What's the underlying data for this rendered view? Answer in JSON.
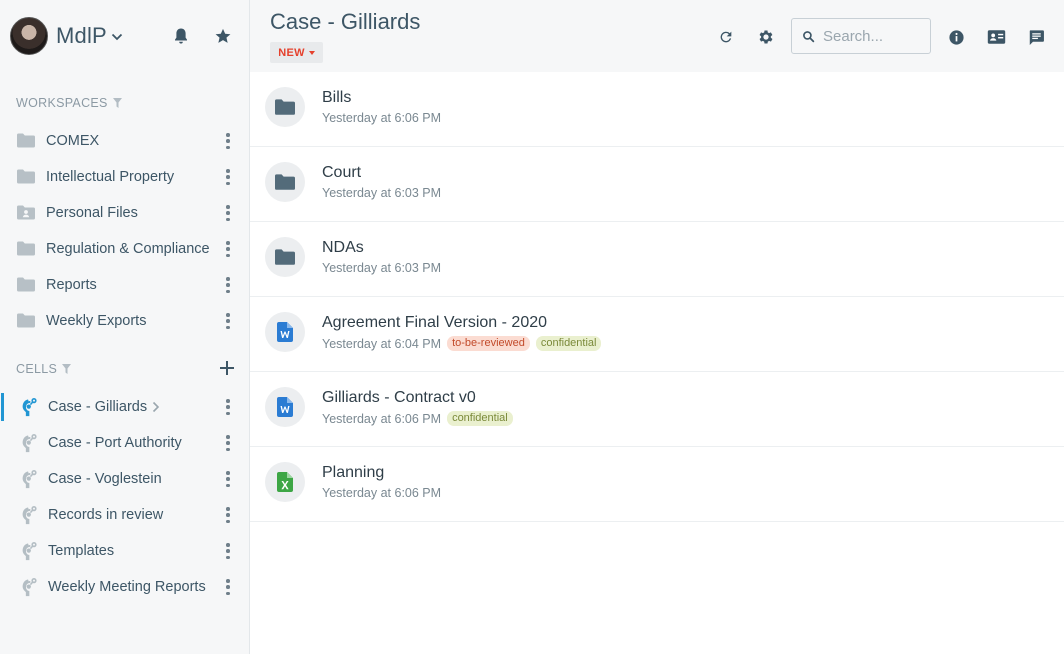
{
  "user": {
    "name": "MdlP"
  },
  "sidebar": {
    "workspaces_title": "WORKSPACES",
    "workspaces": [
      {
        "label": "COMEX",
        "icon": "folder-icon"
      },
      {
        "label": "Intellectual Property",
        "icon": "folder-icon"
      },
      {
        "label": "Personal Files",
        "icon": "folder-account-icon"
      },
      {
        "label": "Regulation & Compliance",
        "icon": "folder-icon"
      },
      {
        "label": "Reports",
        "icon": "folder-icon"
      },
      {
        "label": "Weekly Exports",
        "icon": "folder-icon"
      }
    ],
    "cells_title": "CELLS",
    "cells": [
      {
        "label": "Case - Gilliards",
        "active": true
      },
      {
        "label": "Case - Port Authority"
      },
      {
        "label": "Case - Voglestein"
      },
      {
        "label": "Records in review"
      },
      {
        "label": "Templates"
      },
      {
        "label": "Weekly Meeting Reports"
      }
    ]
  },
  "header": {
    "title": "Case - Gilliards",
    "new_label": "NEW",
    "search_placeholder": "Search..."
  },
  "files": [
    {
      "name": "Bills",
      "date": "Yesterday at 6:06 PM",
      "type": "folder",
      "tags": []
    },
    {
      "name": "Court",
      "date": "Yesterday at 6:03 PM",
      "type": "folder",
      "tags": []
    },
    {
      "name": "NDAs",
      "date": "Yesterday at 6:03 PM",
      "type": "folder",
      "tags": []
    },
    {
      "name": "Agreement Final Version - 2020",
      "date": "Yesterday at 6:04 PM",
      "type": "word",
      "tags": [
        "to-be-reviewed",
        "confidential"
      ]
    },
    {
      "name": "Gilliards - Contract v0",
      "date": "Yesterday at 6:06 PM",
      "type": "word",
      "tags": [
        "confidential"
      ]
    },
    {
      "name": "Planning",
      "date": "Yesterday at 6:06 PM",
      "type": "excel",
      "tags": []
    }
  ],
  "colors": {
    "accent": "#2196d3",
    "folder": "#536b7a",
    "word": "#2b7cd3",
    "excel": "#3da645",
    "tag_review_bg": "#fbdcd2",
    "tag_confidential_bg": "#eaf0cf"
  }
}
